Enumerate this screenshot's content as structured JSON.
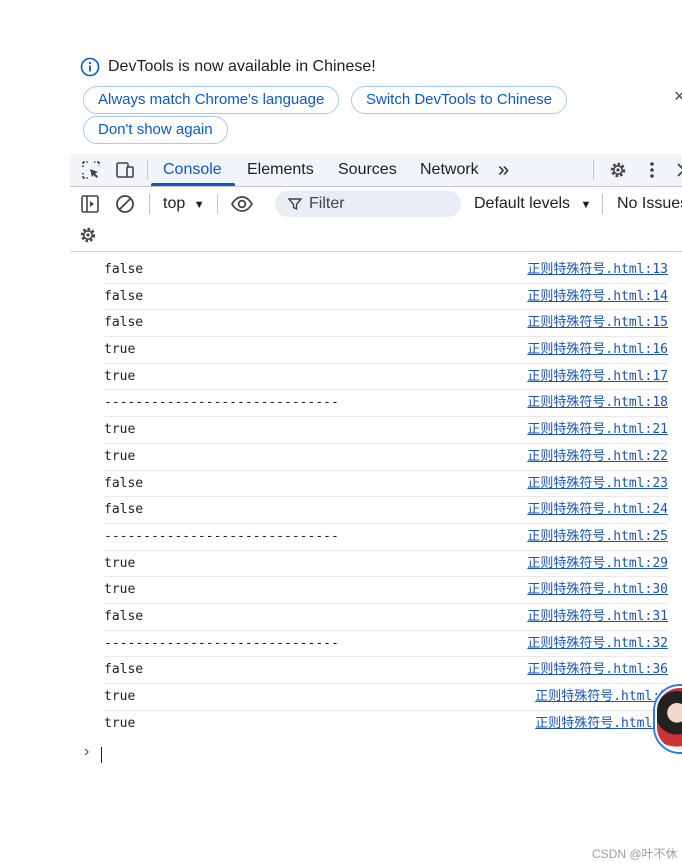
{
  "banner": {
    "message": "DevTools is now available in Chinese!",
    "buttons": [
      "Always match Chrome's language",
      "Switch DevTools to Chinese",
      "Don't show again"
    ],
    "close": "×"
  },
  "tabs": {
    "items": [
      "Console",
      "Elements",
      "Sources",
      "Network"
    ],
    "active": "Console",
    "more": "»"
  },
  "toolbar": {
    "context": "top",
    "filter_placeholder": "Filter",
    "levels": "Default levels",
    "issues": "No Issues"
  },
  "console": {
    "lines": [
      {
        "msg": "false",
        "src": "正则特殊符号.html:13"
      },
      {
        "msg": "false",
        "src": "正则特殊符号.html:14"
      },
      {
        "msg": "false",
        "src": "正则特殊符号.html:15"
      },
      {
        "msg": "true",
        "src": "正则特殊符号.html:16"
      },
      {
        "msg": "true",
        "src": "正则特殊符号.html:17"
      },
      {
        "msg": "------------------------------",
        "src": "正则特殊符号.html:18"
      },
      {
        "msg": "true",
        "src": "正则特殊符号.html:21"
      },
      {
        "msg": "true",
        "src": "正则特殊符号.html:22"
      },
      {
        "msg": "false",
        "src": "正则特殊符号.html:23"
      },
      {
        "msg": "false",
        "src": "正则特殊符号.html:24"
      },
      {
        "msg": "------------------------------",
        "src": "正则特殊符号.html:25"
      },
      {
        "msg": "true",
        "src": "正则特殊符号.html:29"
      },
      {
        "msg": "true",
        "src": "正则特殊符号.html:30"
      },
      {
        "msg": "false",
        "src": "正则特殊符号.html:31"
      },
      {
        "msg": "------------------------------",
        "src": "正则特殊符号.html:32"
      },
      {
        "msg": "false",
        "src": "正则特殊符号.html:36"
      },
      {
        "msg": "true",
        "src": "正则特殊符号.html:3"
      },
      {
        "msg": "true",
        "src": "正则特殊符号.html:3"
      }
    ],
    "prompt": "›"
  },
  "watermark": "CSDN @叶不休",
  "colors": {
    "accent": "#0b57d0",
    "link": "#1a54b8",
    "tabbar_bg": "#f1f4f9"
  }
}
